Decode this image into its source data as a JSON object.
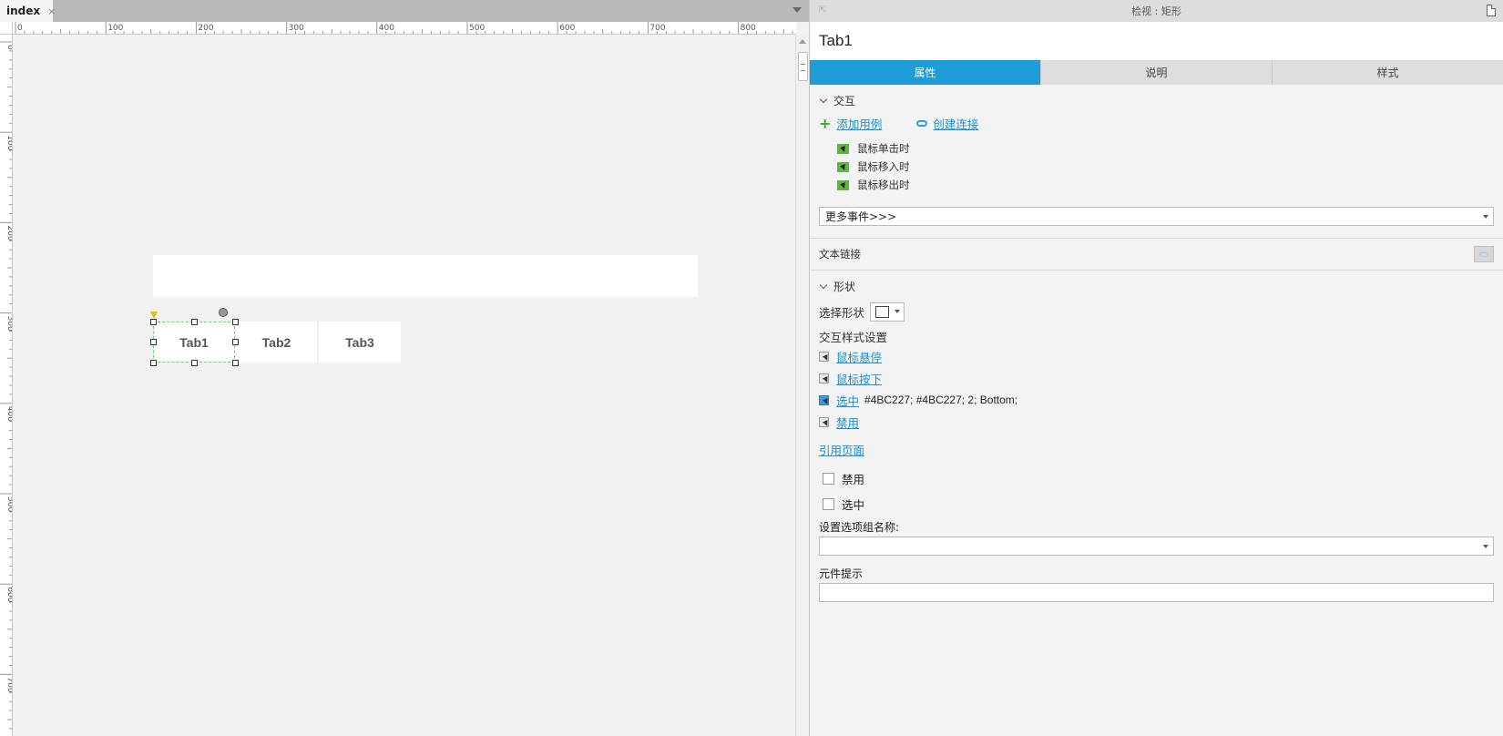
{
  "document_tab": {
    "label": "index",
    "close": "×"
  },
  "ruler": {
    "horizontal_labels": [
      "0",
      "100",
      "200",
      "300",
      "400",
      "500",
      "600",
      "700",
      "800"
    ],
    "vertical_labels": [
      "0",
      "100",
      "200",
      "300",
      "400",
      "500",
      "600",
      "700"
    ]
  },
  "canvas": {
    "tabs": [
      {
        "label": "Tab1",
        "selected": true
      },
      {
        "label": "Tab2",
        "selected": false
      },
      {
        "label": "Tab3",
        "selected": false
      }
    ],
    "selection_color": "#5dd35d"
  },
  "inspector": {
    "header_title": "检视 : 矩形",
    "element_name": "Tab1",
    "tabs": {
      "properties": "属性",
      "notes": "说明",
      "style": "样式"
    },
    "accent_color": "#1e9cd7",
    "interaction": {
      "section_title": "交互",
      "add_case": "添加用例",
      "create_link": "创建连接",
      "events": [
        "鼠标单击时",
        "鼠标移入时",
        "鼠标移出时"
      ],
      "more_events": "更多事件>>>"
    },
    "text_link_label": "文本链接",
    "shape": {
      "section_title": "形状",
      "select_shape_label": "选择形状",
      "interaction_styles_title": "交互样式设置",
      "styles": [
        {
          "label": "鼠标悬停",
          "value": ""
        },
        {
          "label": "鼠标按下",
          "value": ""
        },
        {
          "label": "选中",
          "value": "#4BC227; #4BC227; 2; Bottom;"
        },
        {
          "label": "禁用",
          "value": ""
        }
      ],
      "reference_page": "引用页面",
      "disabled_label": "禁用",
      "selected_label": "选中",
      "option_group_label": "设置选项组名称:",
      "option_group_value": "",
      "tooltip_label": "元件提示",
      "tooltip_value": ""
    }
  }
}
